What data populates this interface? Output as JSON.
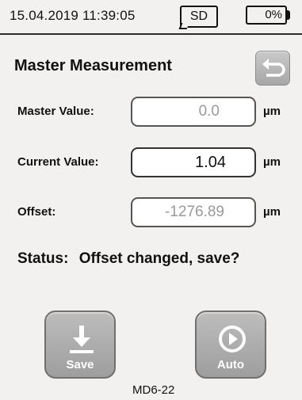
{
  "statusbar": {
    "datetime": "15.04.2019 11:39:05",
    "sd_label": "SD",
    "battery_label": "0%",
    "battery_level": 0
  },
  "header": {
    "title": "Master Measurement",
    "back_icon": "back-arrow-icon"
  },
  "rows": {
    "master": {
      "label": "Master Value:",
      "value": "0.0",
      "unit": "µm"
    },
    "current": {
      "label": "Current Value:",
      "value": "1.04",
      "unit": "µm"
    },
    "offset": {
      "label": "Offset:",
      "value": "-1276.89",
      "unit": "µm"
    }
  },
  "status": {
    "label": "Status:",
    "value": "Offset changed, save?"
  },
  "actions": {
    "save": {
      "label": "Save",
      "icon": "download-arrow-icon"
    },
    "auto": {
      "label": "Auto",
      "icon": "play-circle-icon"
    }
  },
  "footer": {
    "model": "MD6-22"
  },
  "colors": {
    "background": "#f2f1ef",
    "button_gray": "#a7a7a7",
    "readonly_text": "#9a9a9a"
  }
}
